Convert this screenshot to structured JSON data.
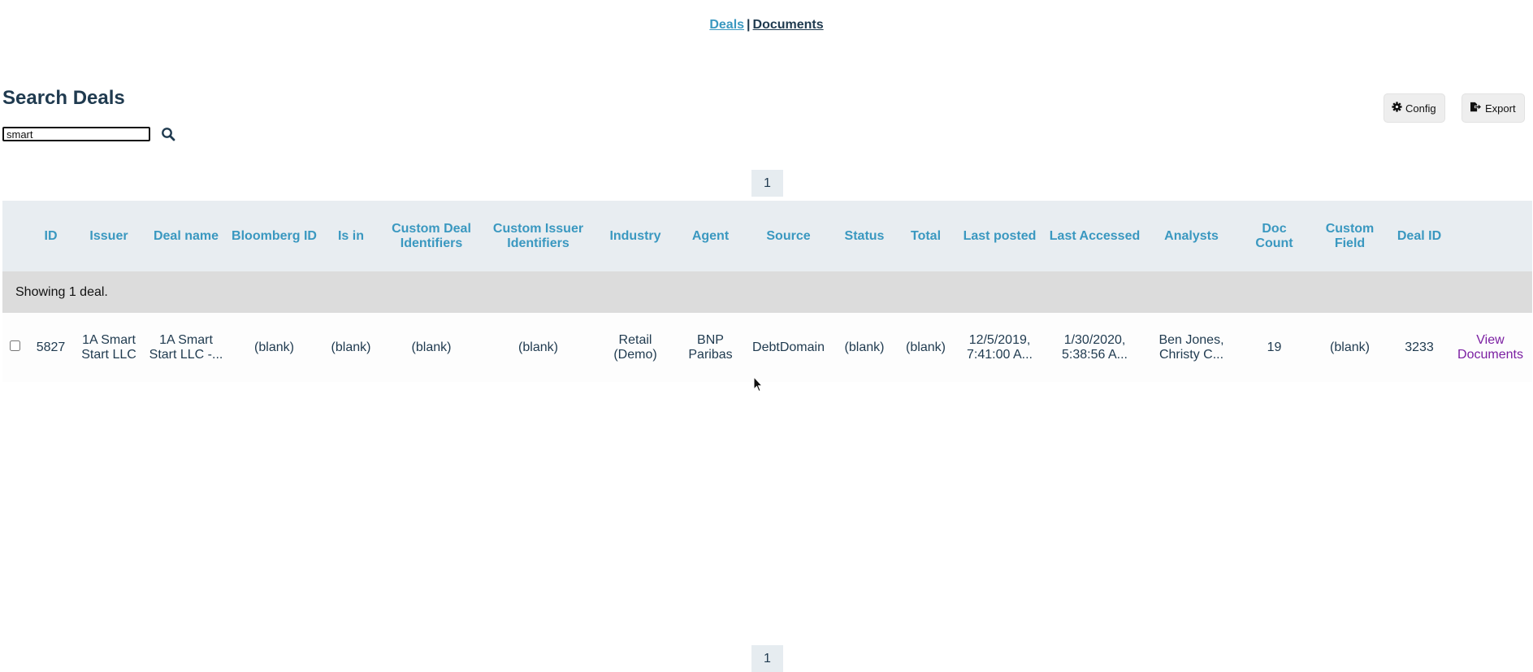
{
  "nav": {
    "deals_label": "Deals",
    "separator": "|",
    "documents_label": "Documents"
  },
  "page": {
    "title": "Search Deals"
  },
  "search": {
    "value": "smart",
    "icon": "search-icon"
  },
  "toolbar": {
    "config_label": "Config",
    "config_icon": "gear-icon",
    "export_label": "Export",
    "export_icon": "export-icon"
  },
  "pagination": {
    "current_page": "1"
  },
  "table": {
    "headers": {
      "id": "ID",
      "issuer": "Issuer",
      "deal_name": "Deal name",
      "bloomberg_id": "Bloomberg ID",
      "is_in": "Is in",
      "custom_deal_identifiers": "Custom Deal Identifiers",
      "custom_issuer_identifiers": "Custom Issuer Identifiers",
      "industry": "Industry",
      "agent": "Agent",
      "source": "Source",
      "status": "Status",
      "total": "Total",
      "last_posted": "Last posted",
      "last_accessed": "Last Accessed",
      "analysts": "Analysts",
      "doc_count": "Doc Count",
      "custom_field": "Custom Field",
      "deal_id": "Deal ID"
    },
    "summary": "Showing 1 deal.",
    "rows": [
      {
        "checked": false,
        "id": "5827",
        "issuer": "1A Smart Start LLC",
        "deal_name": "1A Smart Start LLC -...",
        "bloomberg_id": "(blank)",
        "is_in": "(blank)",
        "custom_deal_identifiers": "(blank)",
        "custom_issuer_identifiers": "(blank)",
        "industry": "Retail (Demo)",
        "agent": "BNP Paribas",
        "source": "DebtDomain",
        "status": "(blank)",
        "total": "(blank)",
        "last_posted": "12/5/2019, 7:41:00 A...",
        "last_accessed": "1/30/2020, 5:38:56 A...",
        "analysts": "Ben Jones, Christy C...",
        "doc_count": "19",
        "custom_field": "(blank)",
        "deal_id": "3233",
        "action": "View Documents"
      }
    ]
  },
  "colors": {
    "header_text": "#3a98c0",
    "header_bg": "#e8edf1",
    "body_text": "#1f3a4f",
    "link_purple": "#7b1fa2",
    "summary_bg": "#dcdcdc"
  }
}
